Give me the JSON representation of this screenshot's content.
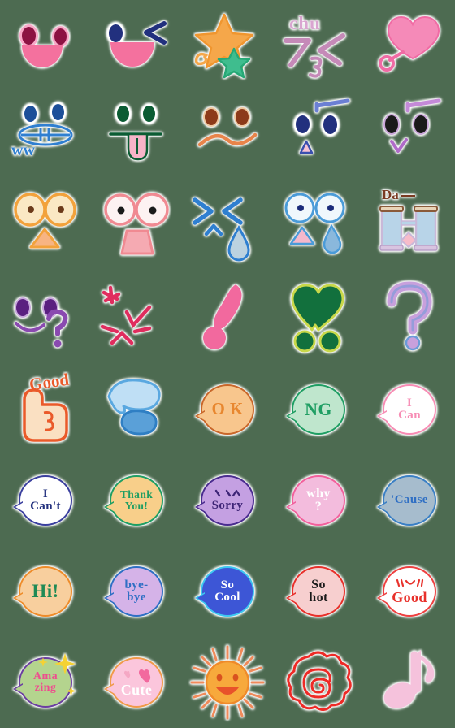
{
  "page": {
    "title": "Emoji Sticker Set Preview",
    "background_color": "#4d6b51",
    "grid": {
      "columns": 5,
      "rows": 8,
      "cell_size": 112,
      "total": 40
    }
  },
  "palette": {
    "pink": "#f4719e",
    "hot_pink": "#ee4d8e",
    "light_pink": "#f9c2d8",
    "maroon": "#8c1242",
    "navy": "#22307e",
    "blue": "#2f6fc4",
    "sky": "#7fc0ea",
    "steel": "#a9c4d8",
    "orange": "#f5a74a",
    "deep_orange": "#e8622b",
    "red": "#e8302a",
    "green": "#0b6b3a",
    "mint": "#b9e3c8",
    "purple": "#6b3fa0",
    "lavender": "#c9a6e0",
    "cream": "#f8e2c2",
    "white": "#ffffff",
    "brown": "#7a3a22"
  },
  "stickers": [
    {
      "id": 1,
      "row": 1,
      "col": 1,
      "name": "smiling-face-pink-mouth",
      "kind": "face",
      "label": ""
    },
    {
      "id": 2,
      "row": 1,
      "col": 2,
      "name": "winking-face-pink-mouth",
      "kind": "face",
      "label": ""
    },
    {
      "id": 3,
      "row": 1,
      "col": 3,
      "name": "shooting-stars",
      "kind": "object",
      "label": ""
    },
    {
      "id": 4,
      "row": 1,
      "col": 4,
      "name": "chu-kiss-text",
      "kind": "text",
      "label": "chu"
    },
    {
      "id": 5,
      "row": 1,
      "col": 5,
      "name": "pink-heart-balloon",
      "kind": "object",
      "label": ""
    },
    {
      "id": 6,
      "row": 2,
      "col": 1,
      "name": "zipper-mouth-face-ww",
      "kind": "face",
      "label": "ww"
    },
    {
      "id": 7,
      "row": 2,
      "col": 2,
      "name": "tongue-out-face",
      "kind": "face",
      "label": ""
    },
    {
      "id": 8,
      "row": 2,
      "col": 3,
      "name": "sad-frown-face",
      "kind": "face",
      "label": ""
    },
    {
      "id": 9,
      "row": 2,
      "col": 4,
      "name": "raised-eyebrow-face",
      "kind": "face",
      "label": ""
    },
    {
      "id": 10,
      "row": 2,
      "col": 5,
      "name": "smirk-eyebrow-face",
      "kind": "face",
      "label": ""
    },
    {
      "id": 11,
      "row": 3,
      "col": 1,
      "name": "big-eyes-orange-face",
      "kind": "face",
      "label": ""
    },
    {
      "id": 12,
      "row": 3,
      "col": 2,
      "name": "shocked-open-mouth-face",
      "kind": "face",
      "label": ""
    },
    {
      "id": 13,
      "row": 3,
      "col": 3,
      "name": "crying-squint-face",
      "kind": "face",
      "label": ""
    },
    {
      "id": 14,
      "row": 3,
      "col": 4,
      "name": "teary-wide-eyes-face",
      "kind": "face",
      "label": ""
    },
    {
      "id": 15,
      "row": 3,
      "col": 5,
      "name": "binoculars-da",
      "kind": "object",
      "label": "Da"
    },
    {
      "id": 16,
      "row": 4,
      "col": 1,
      "name": "question-smile-face",
      "kind": "face",
      "label": "?"
    },
    {
      "id": 17,
      "row": 4,
      "col": 2,
      "name": "anger-marks",
      "kind": "object",
      "label": ""
    },
    {
      "id": 18,
      "row": 4,
      "col": 3,
      "name": "pink-exclamation-mark",
      "kind": "object",
      "label": "!"
    },
    {
      "id": 19,
      "row": 4,
      "col": 4,
      "name": "green-double-exclamation",
      "kind": "object",
      "label": "!!"
    },
    {
      "id": 20,
      "row": 4,
      "col": 5,
      "name": "purple-question-mark",
      "kind": "object",
      "label": "?"
    },
    {
      "id": 21,
      "row": 5,
      "col": 1,
      "name": "thumbs-up-good",
      "kind": "object",
      "label": "Good"
    },
    {
      "id": 22,
      "row": 5,
      "col": 2,
      "name": "blue-water-splash",
      "kind": "object",
      "label": ""
    },
    {
      "id": 23,
      "row": 5,
      "col": 3,
      "name": "bubble-ok",
      "kind": "bubble",
      "label": "O K",
      "fill": "#f8c68d",
      "border": "#c9672a",
      "text_color": "#e8872f"
    },
    {
      "id": 24,
      "row": 5,
      "col": 4,
      "name": "bubble-ng",
      "kind": "bubble",
      "label": "NG",
      "fill": "#bfe6cd",
      "border": "#1f9e63",
      "text_color": "#1f9e63"
    },
    {
      "id": 25,
      "row": 5,
      "col": 5,
      "name": "bubble-i-can",
      "kind": "bubble",
      "label": "I\nCan",
      "fill": "#ffffff",
      "border": "#f78cb4",
      "text_color": "#f78cb4"
    },
    {
      "id": 26,
      "row": 6,
      "col": 1,
      "name": "bubble-i-cant",
      "kind": "bubble",
      "label": "I\nCan't",
      "fill": "#ffffff",
      "border": "#3a3f9e",
      "text_color": "#22307e"
    },
    {
      "id": 27,
      "row": 6,
      "col": 2,
      "name": "bubble-thank-you",
      "kind": "bubble",
      "label": "Thank\nYou!",
      "fill": "#f8cf8a",
      "border": "#1f9e63",
      "text_color": "#1f9e63"
    },
    {
      "id": 28,
      "row": 6,
      "col": 3,
      "name": "bubble-sorry",
      "kind": "bubble",
      "label": "Sorry",
      "fill": "#c4a0e2",
      "border": "#4a2c8f",
      "text_color": "#3d2476"
    },
    {
      "id": 29,
      "row": 6,
      "col": 4,
      "name": "bubble-why",
      "kind": "bubble",
      "label": "why\n?",
      "fill": "#f3bcdd",
      "border": "#f2609c",
      "text_color": "#ffffff"
    },
    {
      "id": 30,
      "row": 6,
      "col": 5,
      "name": "bubble-cause",
      "kind": "bubble",
      "label": "'Cause",
      "fill": "#a6bccd",
      "border": "#3a7fc4",
      "text_color": "#2f6fc4"
    },
    {
      "id": 31,
      "row": 7,
      "col": 1,
      "name": "bubble-hi",
      "kind": "bubble",
      "label": "Hi!",
      "fill": "#f8cf9e",
      "border": "#ee8c2a",
      "text_color": "#1f8a55"
    },
    {
      "id": 32,
      "row": 7,
      "col": 2,
      "name": "bubble-bye-bye",
      "kind": "bubble",
      "label": "bye-\nbye",
      "fill": "#d5b3e8",
      "border": "#2f6fc4",
      "text_color": "#2f6fc4"
    },
    {
      "id": 33,
      "row": 7,
      "col": 3,
      "name": "bubble-so-cool",
      "kind": "bubble",
      "label": "So\nCool",
      "fill": "#3d56d6",
      "border": "#3ec7f0",
      "text_color": "#ffffff"
    },
    {
      "id": 34,
      "row": 7,
      "col": 4,
      "name": "bubble-so-hot",
      "kind": "bubble",
      "label": "So\nhot",
      "fill": "#f7cfcf",
      "border": "#e8302a",
      "text_color": "#1a1a1a"
    },
    {
      "id": 35,
      "row": 7,
      "col": 5,
      "name": "bubble-good-face",
      "kind": "bubble",
      "label": "Good",
      "fill": "#ffffff",
      "border": "#ee4040",
      "text_color": "#e8302a"
    },
    {
      "id": 36,
      "row": 8,
      "col": 1,
      "name": "bubble-amazing",
      "kind": "bubble",
      "label": "Ama\nzing",
      "fill": "#b4d48e",
      "border": "#6b3fa0",
      "text_color": "#ee4d8e"
    },
    {
      "id": 37,
      "row": 8,
      "col": 2,
      "name": "bubble-cute",
      "kind": "bubble",
      "label": "Cute",
      "fill": "#fbc6dc",
      "border": "#f09a4a",
      "text_color": "#ffffff"
    },
    {
      "id": 38,
      "row": 8,
      "col": 3,
      "name": "smiling-sun",
      "kind": "object",
      "label": ""
    },
    {
      "id": 39,
      "row": 8,
      "col": 4,
      "name": "red-scribble-flower",
      "kind": "object",
      "label": ""
    },
    {
      "id": 40,
      "row": 8,
      "col": 5,
      "name": "pink-music-note",
      "kind": "object",
      "label": ""
    }
  ],
  "texts": {
    "chu": "chu",
    "ww": "ww",
    "da": "Da",
    "good_thumb": "Good",
    "ok": "O K",
    "ng": "NG",
    "i_can": "I\nCan",
    "i_cant": "I\nCan't",
    "thank_you": "Thank\nYou!",
    "sorry": "Sorry",
    "why": "why\n?",
    "cause": "'Cause",
    "hi": "Hi!",
    "bye_bye": "bye-\nbye",
    "so_cool": "So\nCool",
    "so_hot": "So\nhot",
    "good": "Good",
    "amazing": "Ama\nzing",
    "cute": "Cute"
  }
}
